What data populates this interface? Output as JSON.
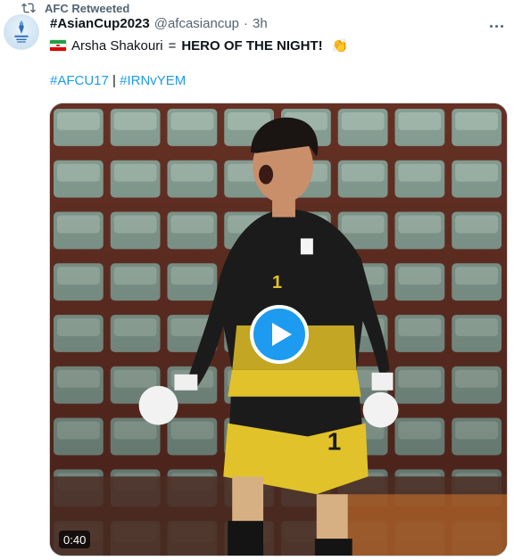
{
  "retweet": {
    "label": "AFC Retweeted",
    "icon": "retweet-icon"
  },
  "tweet": {
    "author_name": "#AsianCup2023",
    "author_handle": "@afcasiancup",
    "separator": "·",
    "time": "3h",
    "avatar_icon": "afc-asian-cup-logo",
    "line1": {
      "flag_icon": "iran-flag-icon",
      "name": "Arsha Shakouri",
      "equals": "=",
      "headline": "HERO OF THE NIGHT!",
      "emoji_icon": "clapping-hands-icon"
    },
    "hashtags": {
      "first": "#AFCU17",
      "divider": "|",
      "second": "#IRNvYEM"
    }
  },
  "media": {
    "type": "video",
    "duration": "0:40",
    "play_icon": "play-icon",
    "jersey_number": "1"
  },
  "colors": {
    "link": "#1d9bf0",
    "text": "#0f1419",
    "muted": "#536471",
    "jersey_black": "#1b1b1b",
    "jersey_yellow": "#e2c22a",
    "stadium_seat": "#8aa79a",
    "stadium_brick": "#7a3a2c"
  }
}
